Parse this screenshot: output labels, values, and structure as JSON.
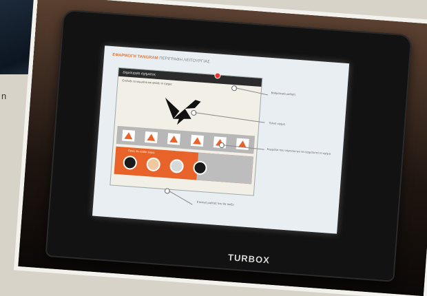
{
  "corner": {
    "letter": "n"
  },
  "laptop": {
    "brand": "TURBOX"
  },
  "slide": {
    "title_left": "ΕΦΑΡΜΟΓΗ TANGRAM",
    "title_right": "ΠΕΡΙΓΡΑΦΗ ΛΕΙΤΟΥΡΓΙΑΣ",
    "app_header": "Δημιουργία σχήματος",
    "app_sub": "Επέλεξε τα κομμάτια και φτιάξε το σχήμα",
    "bottom_hint": "Ποιος θα παίξει τώρα;",
    "callouts": [
      "Βαθμολογία μαθητή",
      "Τελικό σχήμα",
      "Κομμάτια που σύρονται για να σχηματιστεί το σχήμα",
      "Επιλογή μαθητή που θα παίξει"
    ]
  }
}
